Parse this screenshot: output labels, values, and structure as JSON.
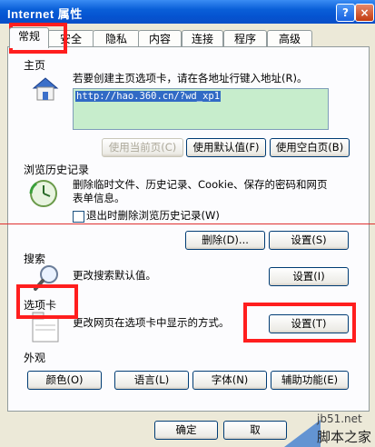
{
  "window": {
    "title": "Internet 属性",
    "help": "?",
    "close": "×"
  },
  "tabs": [
    {
      "label": "常规"
    },
    {
      "label": "安全"
    },
    {
      "label": "隐私"
    },
    {
      "label": "内容"
    },
    {
      "label": "连接"
    },
    {
      "label": "程序"
    },
    {
      "label": "高级"
    }
  ],
  "home": {
    "label": "主页",
    "desc": "若要创建主页选项卡，请在各地址行键入地址(R)。",
    "url": "http://hao.360.cn/?wd_xp1",
    "btn_current": "使用当前页(C)",
    "btn_default": "使用默认值(F)",
    "btn_blank": "使用空白页(B)"
  },
  "history": {
    "label": "浏览历史记录",
    "desc1": "删除临时文件、历史记录、Cookie、保存的密码和网页",
    "desc2": "表单信息。",
    "checkbox": "退出时删除浏览历史记录(W)",
    "btn_delete": "删除(D)...",
    "btn_settings": "设置(S)"
  },
  "search": {
    "label": "搜索",
    "desc": "更改搜索默认值。",
    "btn_settings": "设置(I)"
  },
  "tabs_section": {
    "label": "选项卡",
    "desc": "更改网页在选项卡中显示的方式。",
    "btn_settings": "设置(T)"
  },
  "appearance": {
    "label": "外观",
    "btn_colors": "颜色(O)",
    "btn_languages": "语言(L)",
    "btn_fonts": "字体(N)",
    "btn_access": "辅助功能(E)"
  },
  "footer": {
    "ok": "确定",
    "cancel": "取"
  },
  "watermark": {
    "line1": "jb51.net",
    "line2": "脚本之家"
  }
}
